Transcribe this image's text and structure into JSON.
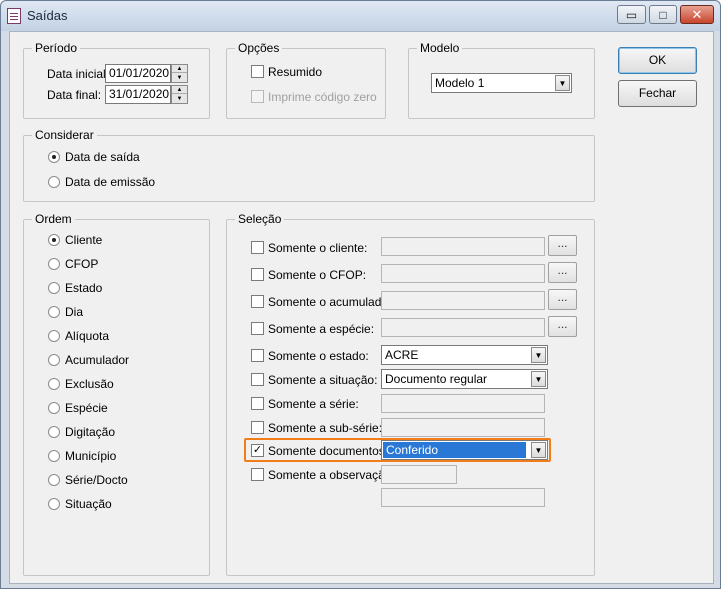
{
  "window": {
    "title": "Saídas",
    "icon": "document-icon",
    "controls": {
      "minimize": "▭",
      "maximize": "□",
      "close": "✕"
    }
  },
  "periodo": {
    "legend": "Período",
    "data_inicial_label": "Data inicial:",
    "data_inicial": "01/01/2020",
    "data_final_label": "Data final:",
    "data_final": "31/01/2020"
  },
  "opcoes": {
    "legend": "Opções",
    "resumido": {
      "label": "Resumido",
      "checked": false
    },
    "imprime_codigo_zero": {
      "label": "Imprime código zero",
      "checked": false,
      "disabled": true
    }
  },
  "modelo": {
    "legend": "Modelo",
    "value": "Modelo 1"
  },
  "buttons": {
    "ok": "OK",
    "fechar": "Fechar"
  },
  "considerar": {
    "legend": "Considerar",
    "options": [
      "Data de saída",
      "Data de emissão"
    ],
    "selected": 0
  },
  "ordem": {
    "legend": "Ordem",
    "options": [
      "Cliente",
      "CFOP",
      "Estado",
      "Dia",
      "Alíquota",
      "Acumulador",
      "Exclusão",
      "Espécie",
      "Digitação",
      "Município",
      "Série/Docto",
      "Situação"
    ],
    "selected": 0
  },
  "selecao": {
    "legend": "Seleção",
    "cliente": {
      "label": "Somente o cliente:",
      "checked": false
    },
    "cfop": {
      "label": "Somente o CFOP:",
      "checked": false
    },
    "acumulador": {
      "label": "Somente o acumulador:",
      "checked": false
    },
    "especie": {
      "label": "Somente a espécie:",
      "checked": false
    },
    "estado": {
      "label": "Somente o estado:",
      "checked": false,
      "value": "ACRE"
    },
    "situacao": {
      "label": "Somente a situação:",
      "checked": false,
      "value": "Documento regular"
    },
    "serie": {
      "label": "Somente a série:",
      "checked": false
    },
    "subserie": {
      "label": "Somente a sub-série:",
      "checked": false
    },
    "documentos": {
      "label": "Somente documentos:",
      "checked": true,
      "value": "Conferido"
    },
    "observacao": {
      "label": "Somente a observação:",
      "checked": false
    },
    "ellipsis": "..."
  },
  "colors": {
    "highlight": "#f07c1a",
    "selection": "#2a78d6"
  }
}
